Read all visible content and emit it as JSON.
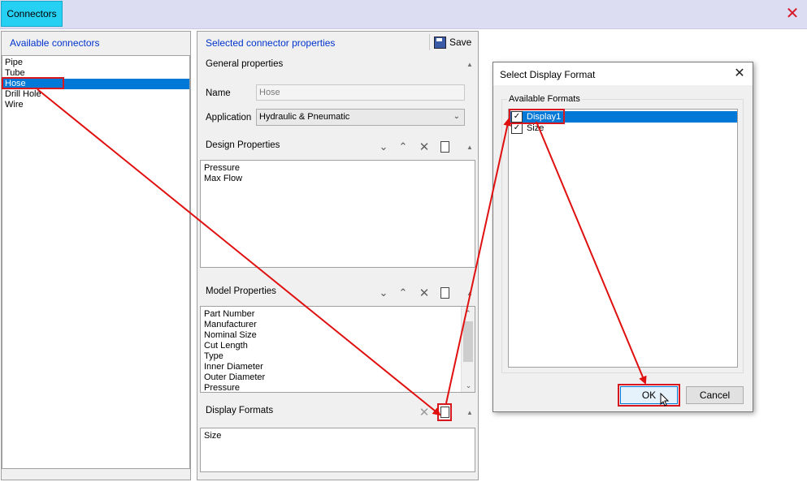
{
  "window": {
    "tab_label": "Connectors"
  },
  "left_panel": {
    "title": "Available connectors",
    "items": [
      "Pipe",
      "Tube",
      "Hose",
      "Drill Hole",
      "Wire"
    ],
    "selected_index": 2
  },
  "middle_panel": {
    "title": "Selected connector properties",
    "save_label": "Save",
    "general": {
      "title": "General properties",
      "name_label": "Name",
      "name_value": "Hose",
      "application_label": "Application",
      "application_value": "Hydraulic & Pneumatic"
    },
    "design": {
      "title": "Design Properties",
      "items": [
        "Pressure",
        "Max Flow"
      ]
    },
    "model": {
      "title": "Model Properties",
      "items": [
        "Part Number",
        "Manufacturer",
        "Nominal Size",
        "Cut Length",
        "Type",
        "Inner Diameter",
        "Outer Diameter",
        "Pressure"
      ]
    },
    "display": {
      "title": "Display Formats",
      "items": [
        "Size"
      ]
    }
  },
  "dialog": {
    "title": "Select Display Format",
    "group_label": "Available Formats",
    "formats": [
      {
        "label": "Display1",
        "checked": true,
        "selected": true
      },
      {
        "label": "Size",
        "checked": true,
        "selected": false
      }
    ],
    "ok_label": "OK",
    "cancel_label": "Cancel"
  },
  "colors": {
    "tab_accent": "#26d0f2",
    "selection": "#0078d7",
    "annotation_red": "#e01010",
    "close_red": "#d8182a"
  }
}
